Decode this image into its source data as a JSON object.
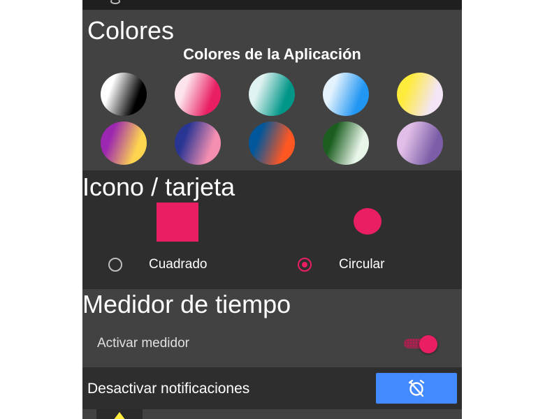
{
  "colors": {
    "title": "Colores",
    "subtitle": "Colores de la Aplicación",
    "accent": "#e91e63",
    "section_bg": "#424242",
    "dark_bg": "#2e2e2e",
    "swatches": [
      {
        "name": "negro-blanco",
        "colors": [
          "#ffffff",
          "#000000"
        ]
      },
      {
        "name": "rosa",
        "colors": [
          "#fce4ec",
          "#e91e63"
        ]
      },
      {
        "name": "verde-azulado",
        "colors": [
          "#e0f2f1",
          "#009688"
        ]
      },
      {
        "name": "azul",
        "colors": [
          "#e3f2fd",
          "#2196f3"
        ]
      },
      {
        "name": "amarillo",
        "colors": [
          "#ffeb3b",
          "#f3e5f5"
        ]
      },
      {
        "name": "purpura-naranja",
        "colors": [
          "#9c27b0",
          "#ffd54f"
        ]
      },
      {
        "name": "azul-rosa",
        "colors": [
          "#283593",
          "#f48fb1"
        ]
      },
      {
        "name": "azul-naranja",
        "colors": [
          "#01579b",
          "#ff5722"
        ]
      },
      {
        "name": "verde-blanco",
        "colors": [
          "#1b5e20",
          "#e8f5e9"
        ]
      },
      {
        "name": "lila",
        "colors": [
          "#e1bee7",
          "#7b5ea7"
        ]
      }
    ]
  },
  "icon_card": {
    "title": "Icono / tarjeta",
    "options": [
      {
        "label": "Cuadrado",
        "selected": false
      },
      {
        "label": "Circular",
        "selected": true
      }
    ]
  },
  "timer": {
    "title": "Medidor de tiempo",
    "toggle_label": "Activar medidor",
    "toggle_on": true
  },
  "notifications": {
    "label": "Desactivar notificaciones",
    "button_icon": "alarm-off-icon",
    "button_color": "#448aff"
  }
}
